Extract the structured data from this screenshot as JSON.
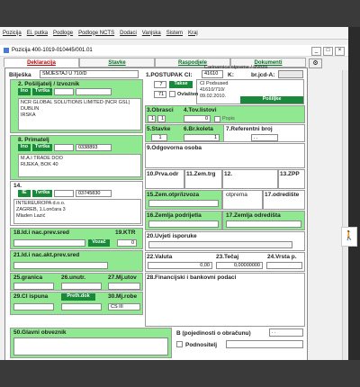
{
  "menu": [
    "Pozicija",
    "Ei. putka",
    "Podloge",
    "Podloge NCTS",
    "Dodaci",
    "Vanjska",
    "Sistem",
    "Kraj"
  ],
  "window_title": "Pozicija 400-1019-010445/001.01",
  "tabs": [
    "Deklaracija",
    "Stavke",
    "Raspodjele",
    "Dokumenti"
  ],
  "biljeska": {
    "label": "Bilješka",
    "value": "SMJEŠTAJ U 710/D"
  },
  "postupak": {
    "label": "1.POSTUPAK CI:",
    "value": "41610",
    "k": "K:",
    "brjcd": "br.jcd-A:"
  },
  "carinarnica": {
    "label": "Carinarnica otpreme / izvoza",
    "lines": [
      "CI Podsused",
      "41610/710/",
      "09.02.2010."
    ]
  },
  "box3": {
    "n1": "7",
    "n2": "71",
    "takse": "Takse",
    "ovlasten": "Ovlašten"
  },
  "posiljatelj": {
    "label": "2. Pošiljatelj / Izvoznik",
    "ino": "Ino",
    "tvrtka": "Tvrtka",
    "lines": [
      "NCR GLOBAL SOLUTIONS LIMITED (NCR GSL)",
      "DUBLIN",
      "IRSKA"
    ]
  },
  "obrasci": {
    "label": "3.Obrasci",
    "a": "1",
    "b": "1"
  },
  "tovlistovi": {
    "label": "4.Tov.listovi",
    "popis": "Popis",
    "posiljke": "Pošiljke",
    "val": "0"
  },
  "stavke": {
    "label": "5.Stavke",
    "val": "1"
  },
  "brkoleta": {
    "label": "6.Br.koleta",
    "val": "1"
  },
  "referentni": {
    "label": "7.Referentni broj",
    "val": ". ."
  },
  "primatelj": {
    "label": "8. Primatelj",
    "ino": "Ino",
    "tvrtka": "Tvrtka",
    "oib": "0338893",
    "lines": [
      "M.A.I TRADE DOO",
      "RIJEKA, BOK 40"
    ]
  },
  "odgovorna": {
    "label": "9.Odgovorna osoba"
  },
  "prvaodr": "10.Prva.odr",
  "zemtrg": "11.Zem.trg",
  "b12": "12.",
  "zpp": "13.ZPP",
  "deklarant": {
    "label": "14.",
    "ie": "IE",
    "tvrtka": "Tvrtka",
    "oib": "03745830",
    "lines": [
      "INTEREUROPA d.o.o.",
      "ZAGREB, 1.Lončara 3",
      "Mladen Lazić"
    ]
  },
  "zemotpr": "15.Zem.otpr/izvoza",
  "otprema": "otprema",
  "odrediste17": "17.odredište",
  "zemljapodr": "16.Zemlja podrijetla",
  "zemljaodr": "17.Zemlja odredišta",
  "b18": {
    "label": "18.Id.i nac.prev.sred",
    "ktr": "19.KTR",
    "ktrval": "0",
    "vozac": "Vozač"
  },
  "uvjeti": "20.Uvjeti isporuke",
  "b21": "21.Id.i nac.akt.prev.sred",
  "valuta": {
    "label": "22.Valuta",
    "val": "0,00"
  },
  "tecaj": {
    "label": "23.Tečaj",
    "val": "0,00000000"
  },
  "prvstp": "24.Vrsta p.",
  "granica": "25.granica",
  "unutr": "26.unutr.",
  "mjutov": "27.Mj.utov",
  "financ": "28.Financijski i bankovni podaci",
  "b29": {
    "label": "29.CI ispuna",
    "preth": "Preth.dok"
  },
  "mjrobe": {
    "label": "30.Mj.robe",
    "val": "CS III"
  },
  "glavni": "50.Glavni obveznik",
  "bpodaci": {
    "label": "B (pojedinosti o obračunu)",
    "dots": ". ."
  },
  "podnositelj": "Podnositelj"
}
